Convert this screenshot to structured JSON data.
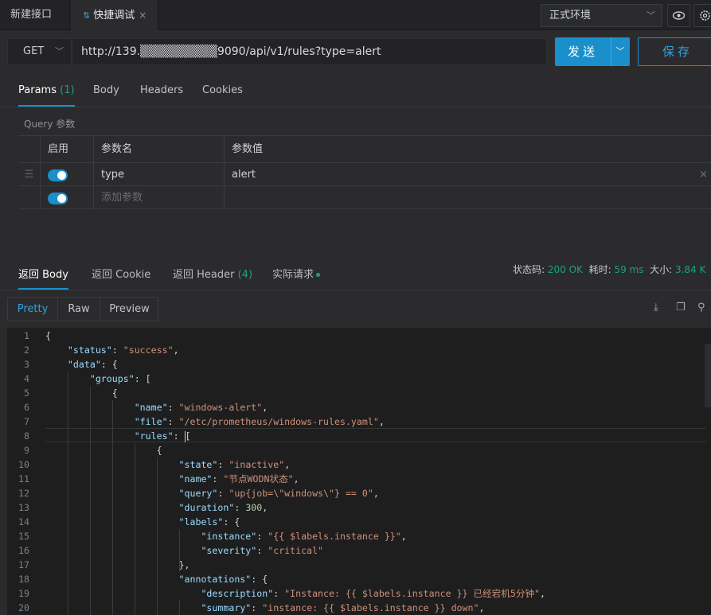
{
  "tabs": {
    "new_api": "新建接口",
    "quick_debug": "快捷调试",
    "quick_debug_close": "×"
  },
  "environment": {
    "selected": "正式环境"
  },
  "request": {
    "method": "GET",
    "url": "http://139.▒▒▒▒▒▒▒▒▒9090/api/v1/rules?type=alert",
    "send_label": "发送",
    "save_label": "保存"
  },
  "request_tabs": {
    "params": "Params",
    "params_count": "(1)",
    "body": "Body",
    "headers": "Headers",
    "cookies": "Cookies"
  },
  "query": {
    "section_label": "Query 参数",
    "headers": {
      "enabled": "启用",
      "name": "参数名",
      "value": "参数值"
    },
    "rows": [
      {
        "enabled": true,
        "name": "type",
        "value": "alert"
      }
    ],
    "add_placeholder": "添加参数"
  },
  "response_tabs": {
    "body": "返回 Body",
    "cookie": "返回 Cookie",
    "header": "返回 Header",
    "header_count": "(4)",
    "actual": "实际请求"
  },
  "status": {
    "code_label": "状态码:",
    "code_value": "200 OK",
    "time_label": "耗时:",
    "time_value": "59 ms",
    "size_label": "大小:",
    "size_value": "3.84 K"
  },
  "view_tabs": {
    "pretty": "Pretty",
    "raw": "Raw",
    "preview": "Preview"
  },
  "code_lines": [
    "{",
    "    \"status\": \"success\",",
    "    \"data\": {",
    "        \"groups\": [",
    "            {",
    "                \"name\": \"windows-alert\",",
    "                \"file\": \"/etc/prometheus/windows-rules.yaml\",",
    "                \"rules\": [",
    "                    {",
    "                        \"state\": \"inactive\",",
    "                        \"name\": \"节点WODN状态\",",
    "                        \"query\": \"up{job=\\\"windows\\\"} == 0\",",
    "                        \"duration\": 300,",
    "                        \"labels\": {",
    "                            \"instance\": \"{{ $labels.instance }}\",",
    "                            \"severity\": \"critical\"",
    "                        },",
    "                        \"annotations\": {",
    "                            \"description\": \"Instance: {{ $labels.instance }} 已经宕机5分钟\",",
    "                            \"summary\": \"instance: {{ $labels.instance }} down\","
  ]
}
